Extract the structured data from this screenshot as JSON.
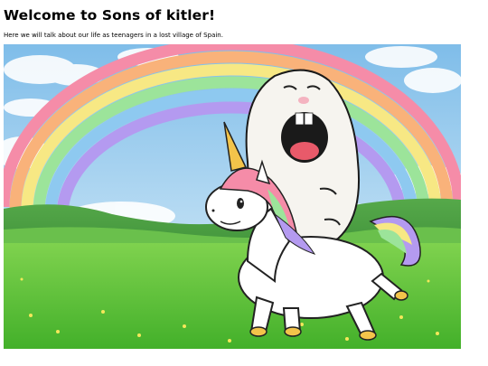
{
  "page": {
    "heading": "Welcome to Sons of kitler!",
    "intro": "Here we will talk about our life as teenagers in a lost village of Spain."
  },
  "hero": {
    "icon": "illustration-unicorn-rainbow",
    "palette": {
      "sky": "#8ec8ef",
      "grass": "#5cc23a",
      "rainbow": [
        "#f58ca8",
        "#f9b27a",
        "#f7e884",
        "#9ce49a",
        "#8ec9f0",
        "#b49af0"
      ],
      "unicorn": "#ffffff",
      "horn": "#f3c44a"
    }
  }
}
